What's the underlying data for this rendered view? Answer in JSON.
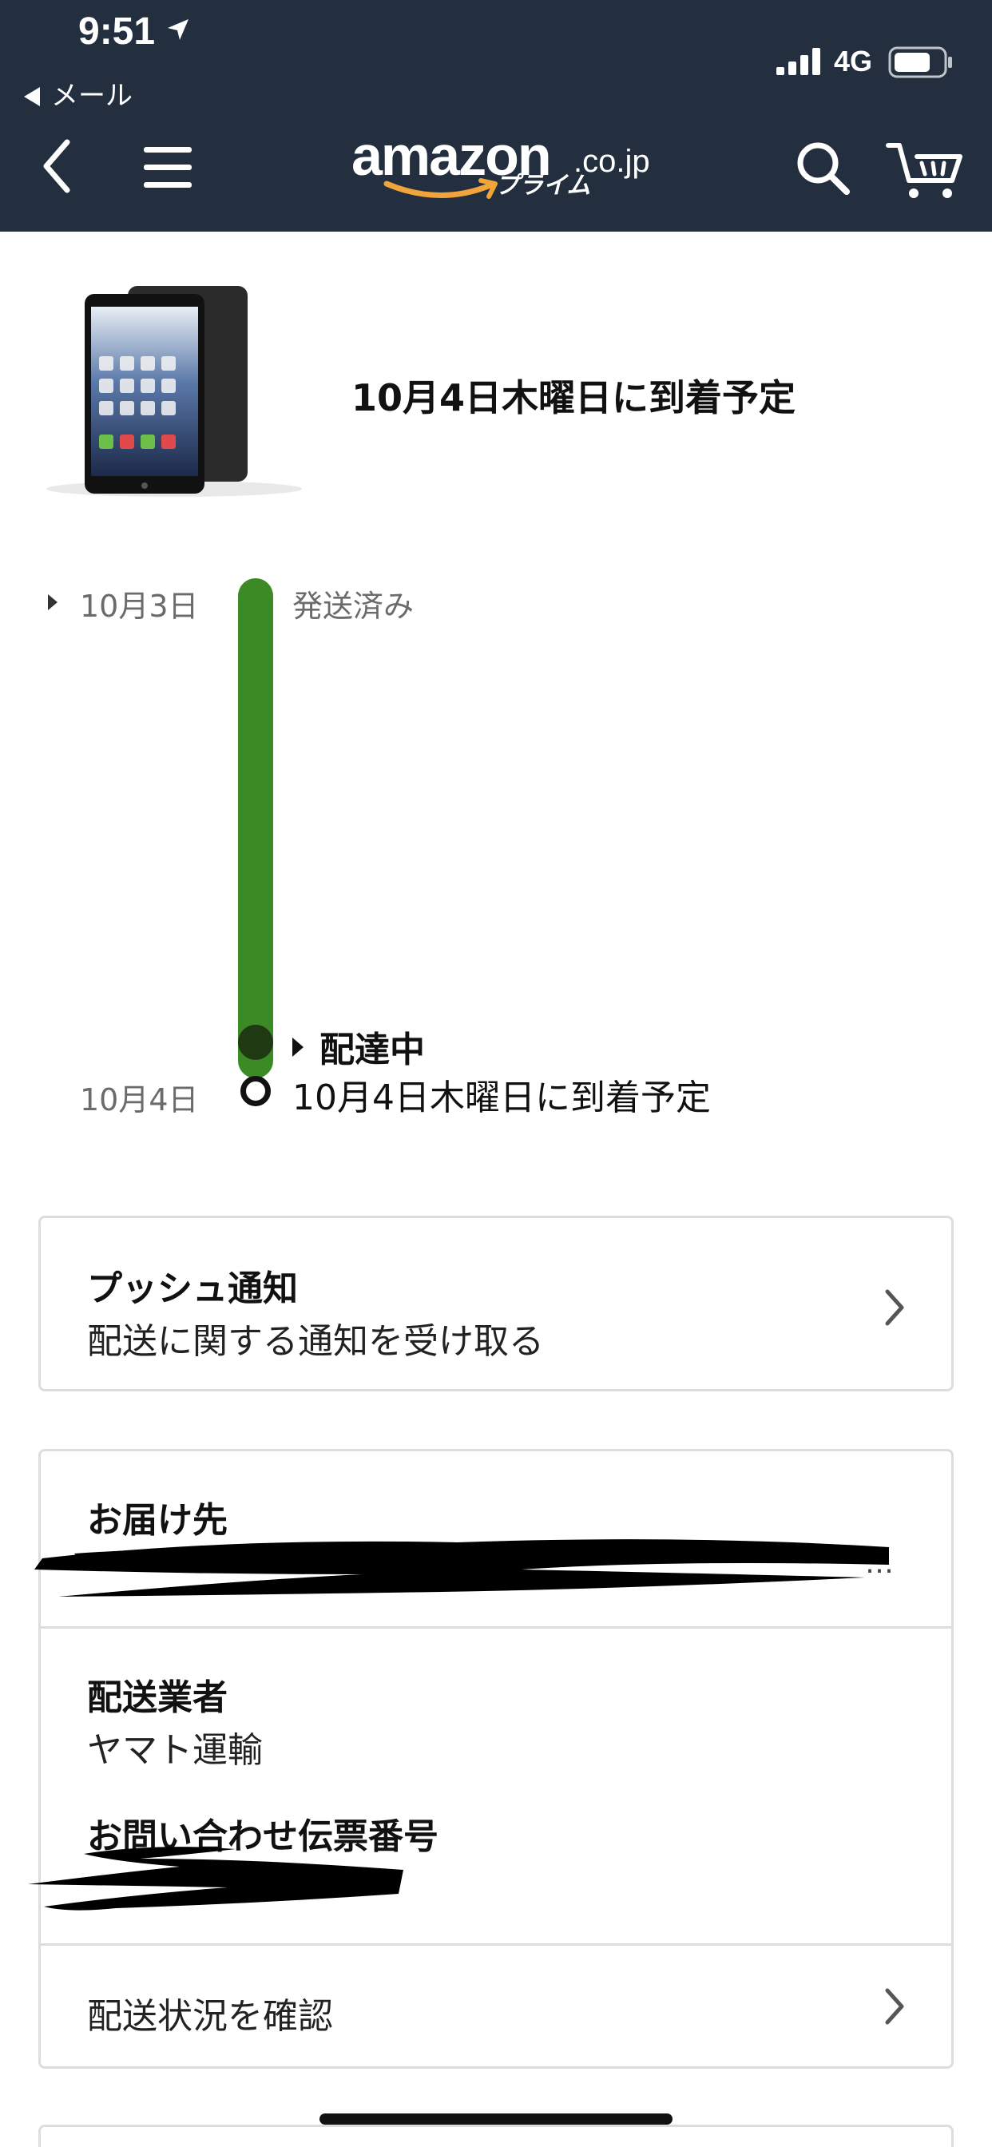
{
  "status_bar": {
    "time": "9:51",
    "back_app": "メール",
    "network": "4G"
  },
  "header": {
    "logo_text": "amazon",
    "logo_tld": ".co.jp",
    "logo_sub": "プライム",
    "colors": {
      "background": "#232f3e",
      "smile": "#f0a43a"
    }
  },
  "order": {
    "arrival_title": "10月4日木曜日に到着予定"
  },
  "timeline": {
    "start_date": "10月3日",
    "start_status": "発送済み",
    "current_status": "配達中",
    "end_date": "10月4日",
    "end_status": "10月4日木曜日に到着予定",
    "colors": {
      "progress": "#3b8a26"
    }
  },
  "push": {
    "title": "プッシュ通知",
    "subtitle": "配送に関する通知を受け取る"
  },
  "shipment": {
    "destination_label": "お届け先",
    "destination_truncation": "…",
    "carrier_label": "配送業者",
    "carrier_name": "ヤマト運輸",
    "tracking_label": "お問い合わせ伝票番号",
    "status_link": "配送状況を確認"
  }
}
